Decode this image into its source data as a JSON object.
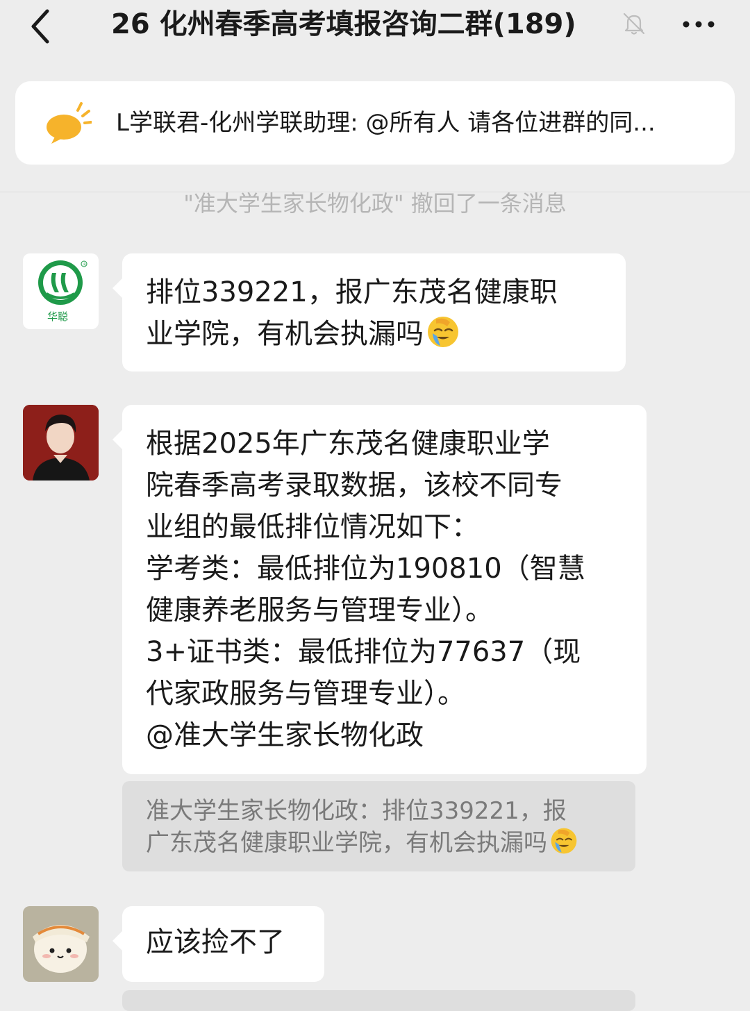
{
  "header": {
    "title": "26 化州春季高考填报咨询二群(189)"
  },
  "pinned_notice": {
    "text": "L学联君-化州学联助理: @所有人 请各位进群的同..."
  },
  "system_message": "\"准大学生家长物化政\" 撤回了一条消息",
  "messages": [
    {
      "avatar_label": "华聪",
      "lines": [
        "排位339221，报广东茂名健康职",
        "业学院，有机会执漏吗"
      ],
      "emoji": "facepalm-emoji"
    },
    {
      "lines": [
        "根据2025年广东茂名健康职业学",
        "院春季高考录取数据，该校不同专",
        "业组的最低排位情况如下：",
        "学考类：最低排位为190810（智慧",
        "健康养老服务与管理专业）。",
        "3+证书类：最低排位为77637（现",
        "代家政服务与管理专业）。",
        "@准大学生家长物化政"
      ],
      "quote": {
        "lines": [
          "准大学生家长物化政：排位339221，报",
          "广东茂名健康职业学院，有机会执漏吗"
        ],
        "emoji": "facepalm-emoji"
      }
    },
    {
      "lines": [
        "应该捡不了"
      ]
    }
  ],
  "colors": {
    "background": "#ededed",
    "bubble": "#ffffff",
    "quote_background": "#dedede",
    "system_text": "#b5b5b5",
    "logo_green": "#1f9a49"
  }
}
